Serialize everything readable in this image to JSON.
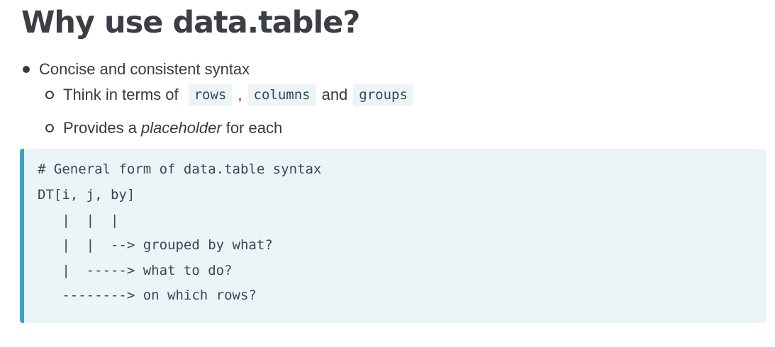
{
  "slide": {
    "title": "Why use data.table?",
    "bullet1": "Concise and consistent syntax",
    "sub1": {
      "prefix": "Think in terms of",
      "code1": "rows",
      "sep1": ",",
      "code2": "columns",
      "sep2": "and",
      "code3": "groups"
    },
    "sub2": {
      "prefix": "Provides a",
      "emphasis": "placeholder",
      "suffix": "for each"
    }
  },
  "code_block": {
    "lines": [
      "# General form of data.table syntax",
      "DT[i, j, by]",
      "   |  |  |",
      "   |  |  --> grouped by what?",
      "   |  -----> what to do?",
      "   --------> on which rows?"
    ]
  },
  "colors": {
    "title": "#3b3f44",
    "text": "#3a3a3a",
    "code_text": "#33495a",
    "code_bg": "#ebf4f6",
    "code_border": "#3aa3c4"
  }
}
